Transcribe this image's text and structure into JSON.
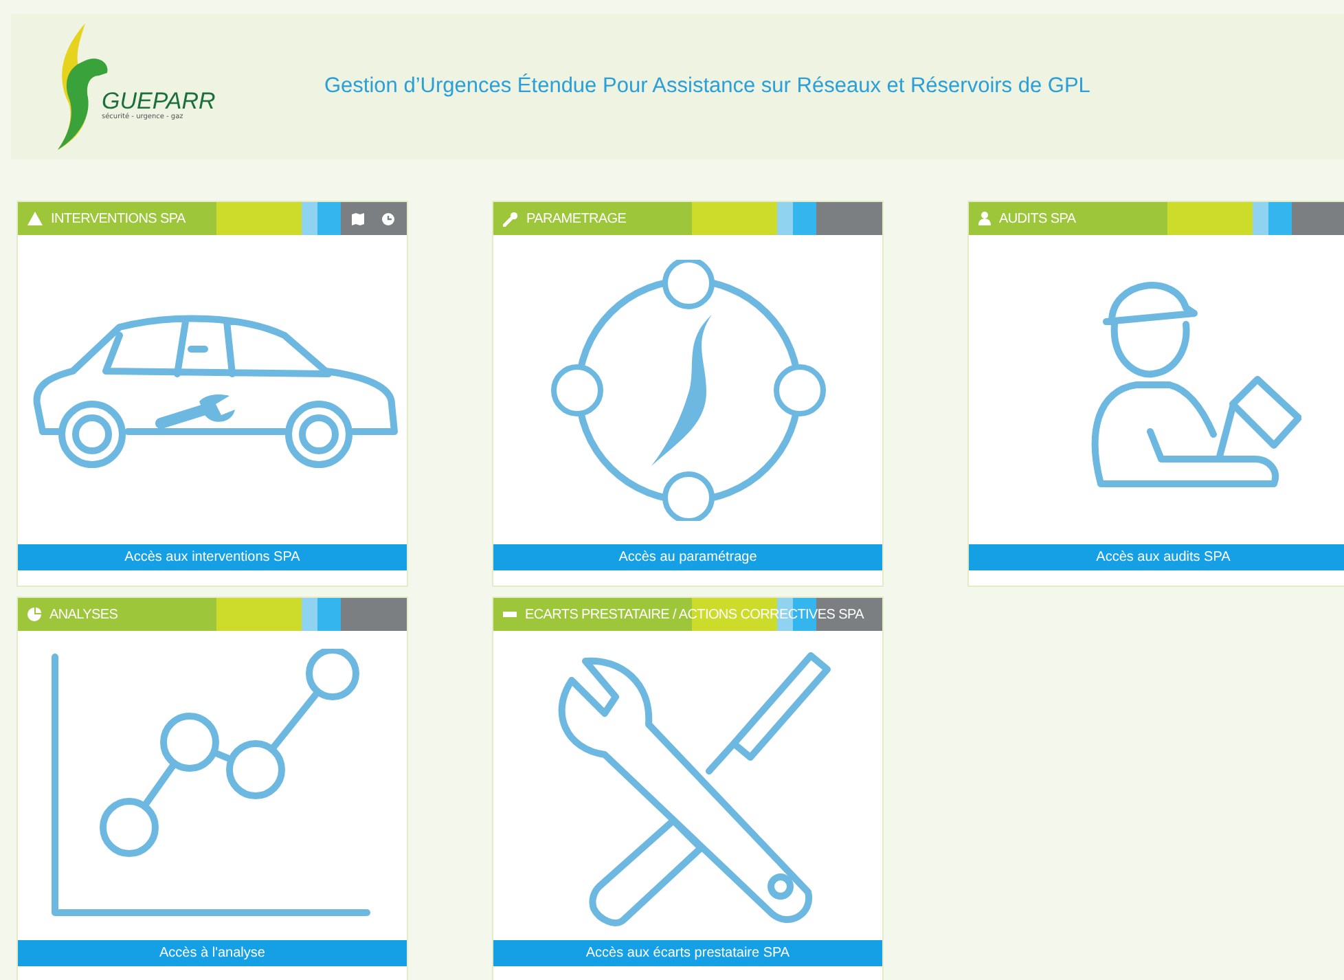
{
  "header": {
    "logo_name": "GUEPARR",
    "logo_tagline": "sécurité - urgence - gaz",
    "title": "Gestion d’Urgences Étendue Pour Assistance sur Réseaux et Réservoirs de GPL"
  },
  "tiles": [
    {
      "kind": "interventions",
      "title": "INTERVENTIONS SPA",
      "link": "Accès aux interventions SPA"
    },
    {
      "kind": "settings",
      "title": "PARAMETRAGE",
      "link": "Accès au paramétrage"
    },
    {
      "kind": "audits",
      "title": "AUDITS SPA",
      "link": "Accès aux audits SPA"
    },
    {
      "kind": "analyses",
      "title": "ANALYSES",
      "link": "Accès à l'analyse"
    },
    {
      "kind": "gaps",
      "title": "ECARTS PRESTATAIRE / ACTIONS CORRECTIVES SPA",
      "link": "Accès aux écarts prestataire SPA"
    }
  ]
}
